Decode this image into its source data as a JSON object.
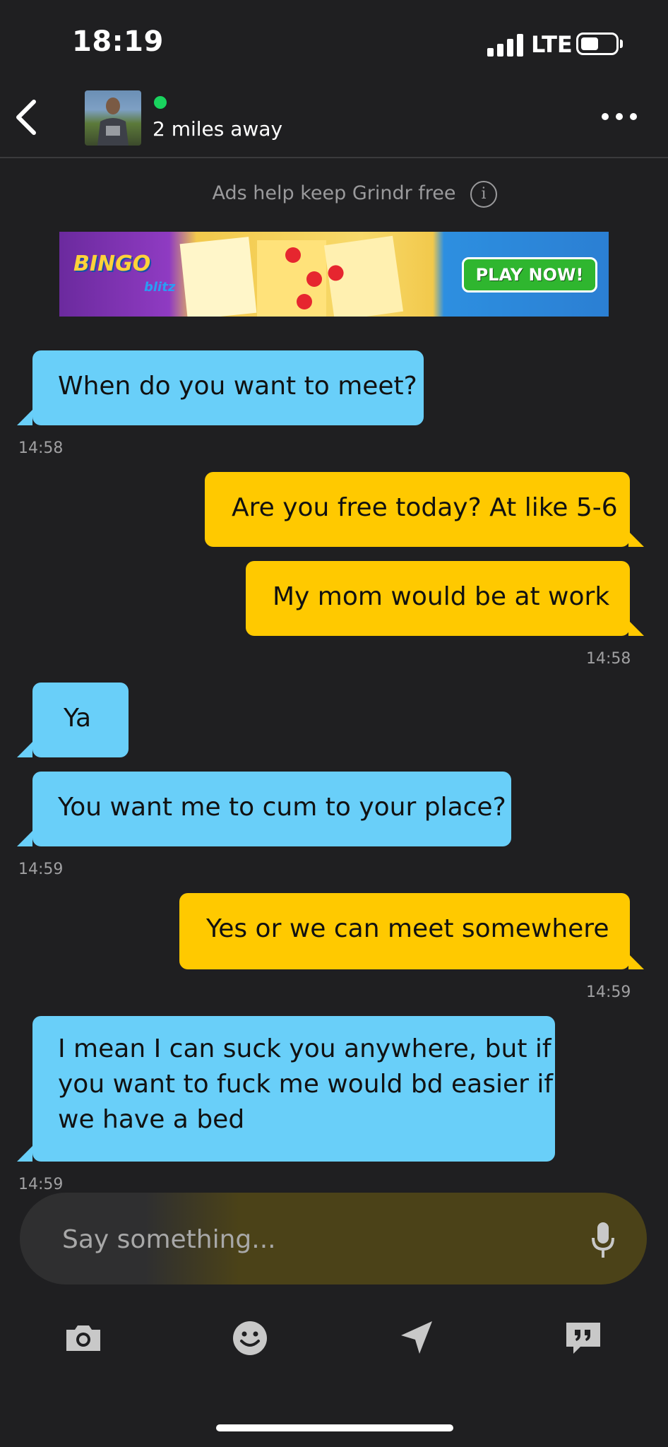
{
  "status_bar": {
    "time": "18:19",
    "network": "LTE"
  },
  "header": {
    "distance": "2 miles away"
  },
  "ad": {
    "notice": "Ads help keep Grindr free",
    "brand": "BINGO",
    "brand_sub": "blitz",
    "cta": "PLAY NOW!"
  },
  "messages": [
    {
      "dir": "in",
      "text": "When do you want to meet?"
    },
    {
      "dir": "out",
      "text": "Are you free today? At like 5-6"
    },
    {
      "dir": "out",
      "text": "My mom would be at work"
    },
    {
      "dir": "in",
      "text": "Ya"
    },
    {
      "dir": "in",
      "text": "You want me to cum to your place?"
    },
    {
      "dir": "out",
      "text": "Yes or we can meet somewhere"
    },
    {
      "dir": "in",
      "lines": [
        "I mean I can suck you anywhere, but if",
        "you want to fuck me would bd easier if",
        "we have a bed"
      ]
    }
  ],
  "timestamps": [
    "14:58",
    "14:58",
    "14:59",
    "14:59",
    "14:59"
  ],
  "composer": {
    "placeholder": "Say something..."
  },
  "toolbar": [
    "camera-icon",
    "emoji-icon",
    "location-icon",
    "saved-phrases-icon"
  ]
}
